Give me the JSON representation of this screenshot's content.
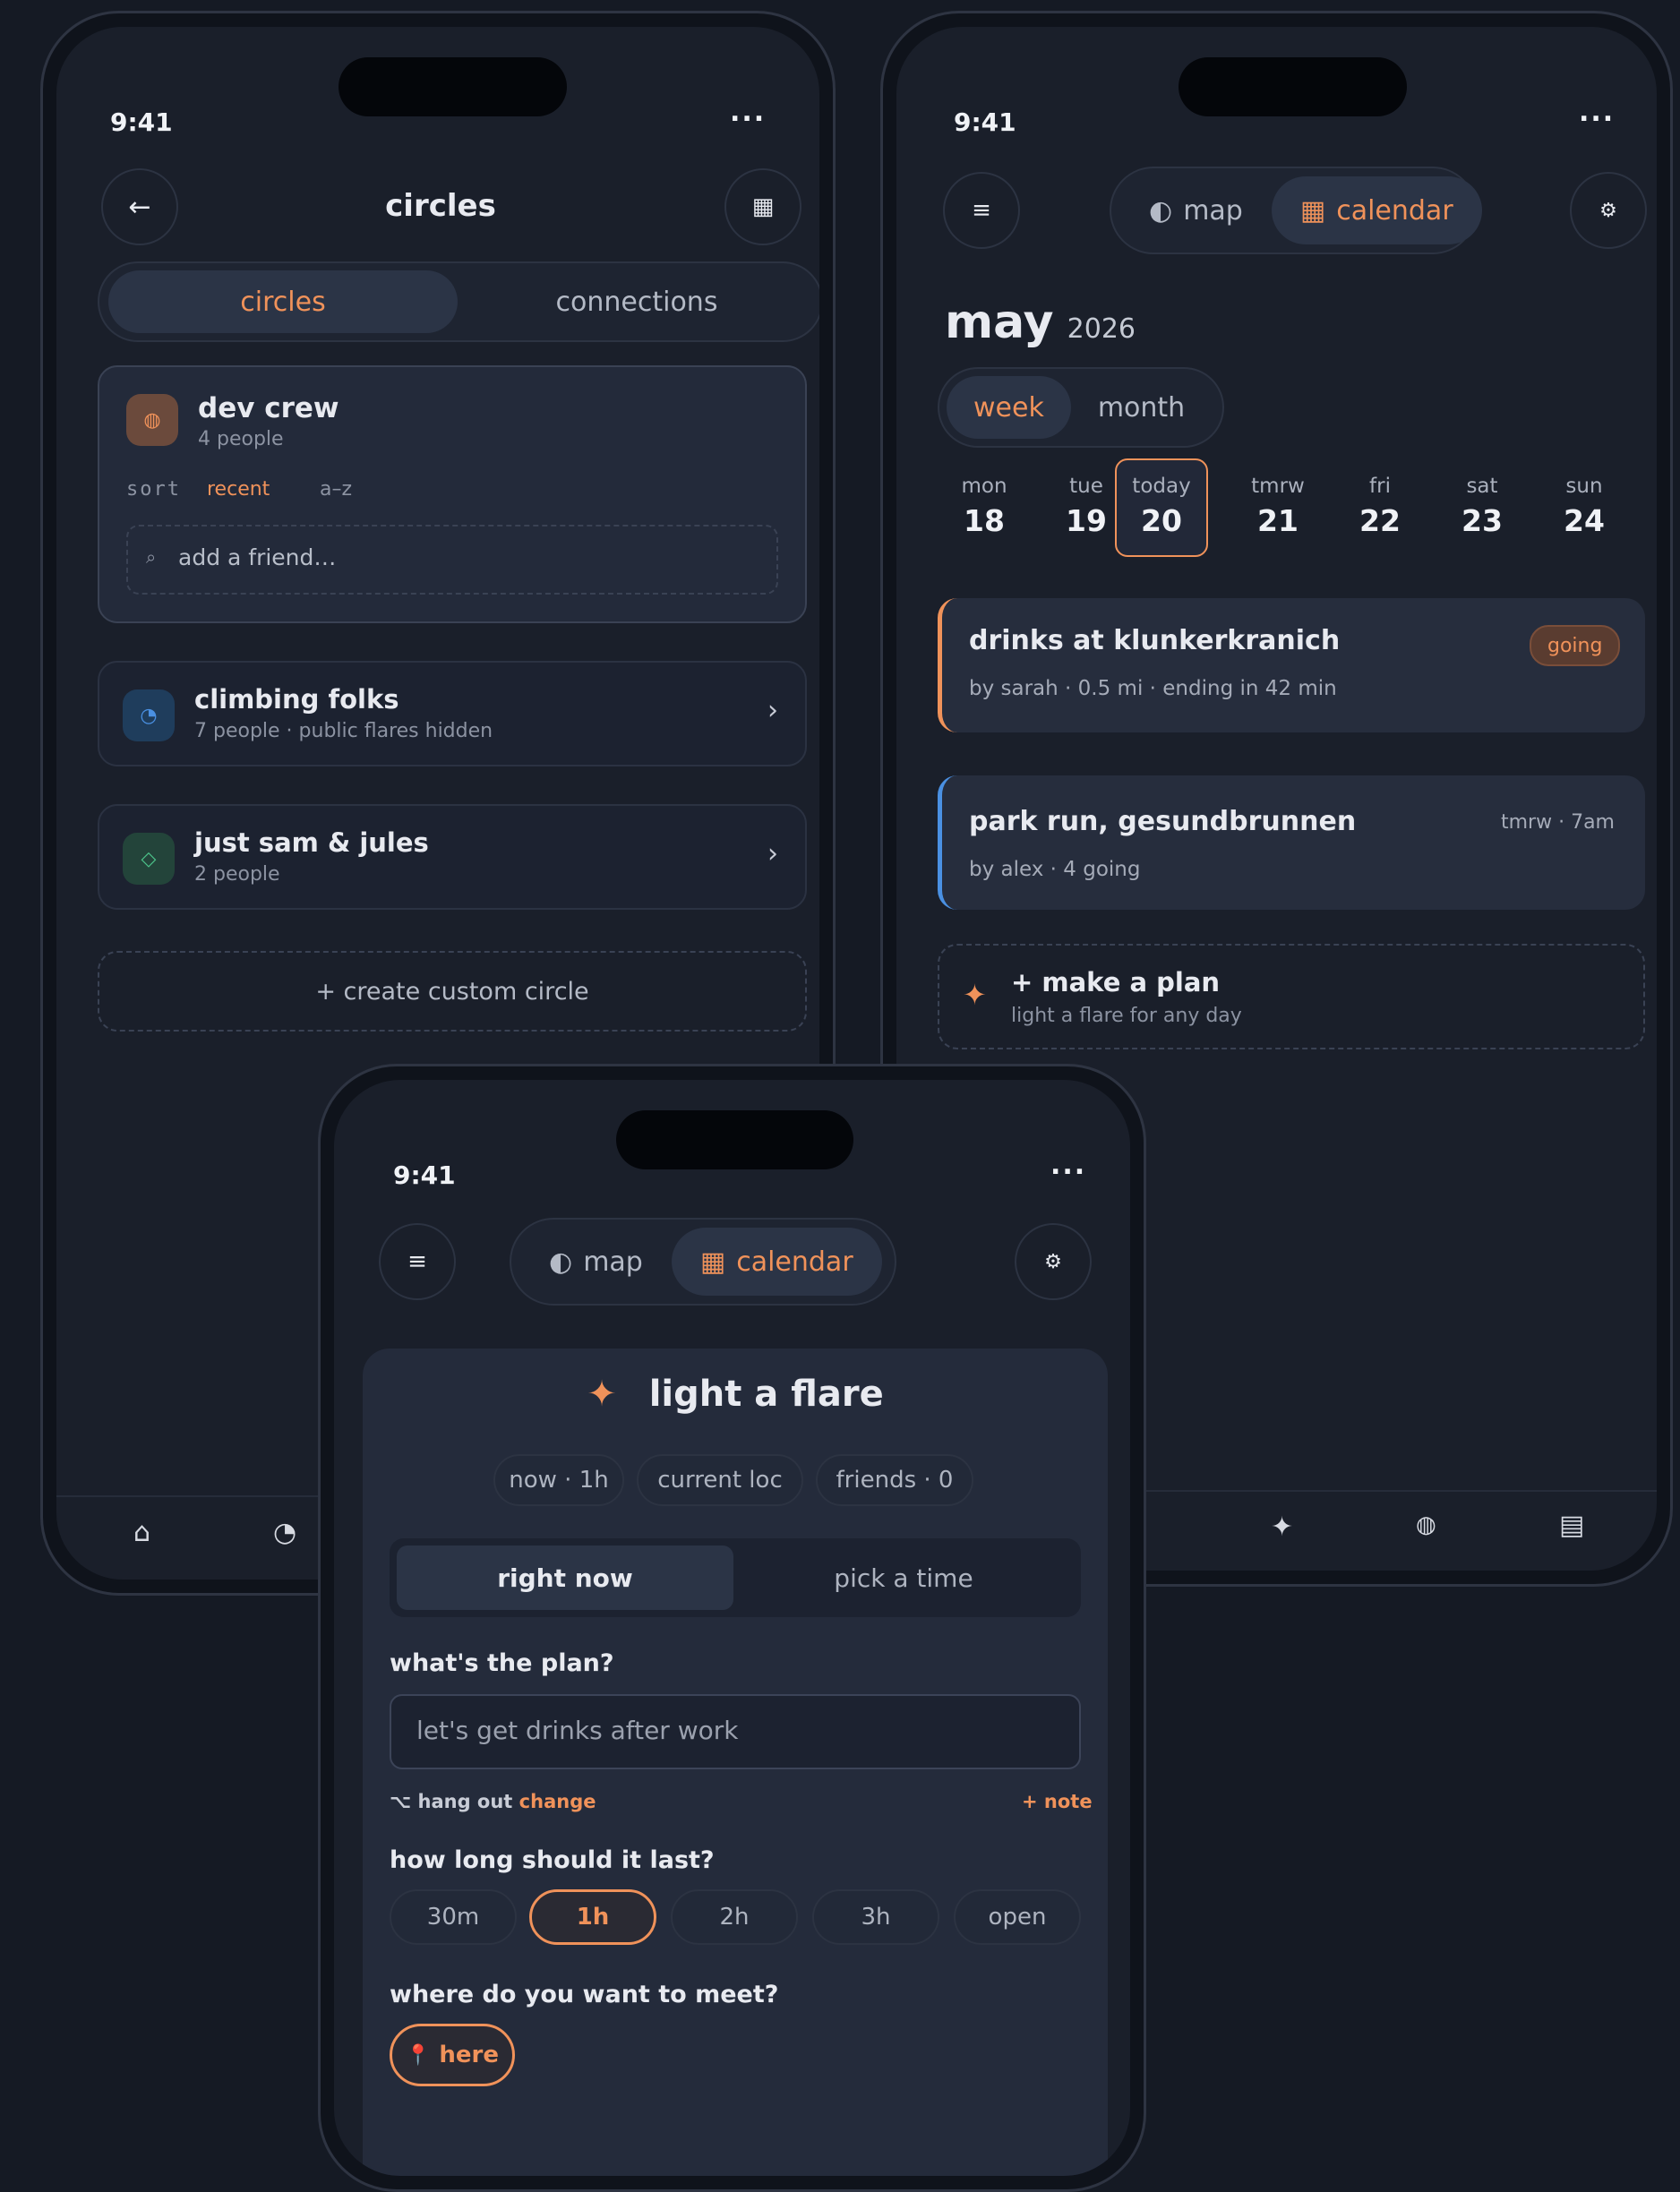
{
  "status": {
    "time": "9:41",
    "more": "..."
  },
  "circles_screen": {
    "title": "circles",
    "back_icon": "←",
    "grid_icon": "▦",
    "tabs": [
      {
        "label": "circles",
        "active": true
      },
      {
        "label": "connections",
        "active": false
      }
    ],
    "expanded_circle": {
      "name": "dev crew",
      "count": "4 people",
      "icon": "◍",
      "sort_label": "sort",
      "sort_options": [
        "recent",
        "a–z"
      ],
      "add_icon": "⌕",
      "add_placeholder": "add a friend…"
    },
    "circles": [
      {
        "name": "climbing folks",
        "meta": "7 people · public flares hidden",
        "icon": "◔",
        "chevron": "›"
      },
      {
        "name": "just sam & jules",
        "meta": "2 people",
        "icon": "◇",
        "chevron": "›"
      }
    ],
    "create_label": "+ create custom circle",
    "nav_icons": [
      "⌂",
      "◔"
    ]
  },
  "calendar_screen": {
    "menu_icon": "≡",
    "settings_icon": "⚙",
    "view_toggle": {
      "map_label": "map",
      "map_icon": "◐",
      "calendar_label": "calendar",
      "calendar_icon": "▦",
      "active": "calendar"
    },
    "month": "may",
    "year": "2026",
    "range_toggle": {
      "week": "week",
      "month": "month",
      "active": "week"
    },
    "days": [
      {
        "label": "mon",
        "num": "18"
      },
      {
        "label": "tue",
        "num": "19"
      },
      {
        "label": "today",
        "num": "20",
        "today": true
      },
      {
        "label": "tmrw",
        "num": "21"
      },
      {
        "label": "fri",
        "num": "22"
      },
      {
        "label": "sat",
        "num": "23"
      },
      {
        "label": "sun",
        "num": "24"
      }
    ],
    "events": [
      {
        "title": "drinks at klunkerkranich",
        "meta": "by sarah · 0.5 mi · ending in 42 min",
        "badge": "going",
        "accent": "#f0925a"
      },
      {
        "title": "park run, gesundbrunnen",
        "meta": "by alex · 4 going",
        "when": "tmrw · 7am",
        "accent": "#4a90e2"
      }
    ],
    "make_plan": {
      "icon": "✦",
      "title": "+ make a plan",
      "subtitle": "light a flare for any day"
    },
    "nav_icons": [
      "✦",
      "◍",
      "▤"
    ]
  },
  "flare_screen": {
    "menu_icon": "≡",
    "settings_icon": "⚙",
    "view_toggle": {
      "map_label": "map",
      "map_icon": "◐",
      "calendar_label": "calendar",
      "calendar_icon": "▦",
      "active": "calendar"
    },
    "sheet": {
      "icon": "✦",
      "title": "light a flare",
      "chips": [
        "now · 1h",
        "current loc",
        "friends · 0"
      ],
      "timing_tabs": [
        {
          "label": "right now",
          "active": true
        },
        {
          "label": "pick a time",
          "active": false
        }
      ],
      "plan_question": "what's the plan?",
      "plan_placeholder": "let's get drinks after work",
      "category_icon": "⌥",
      "category_label": "hang out",
      "category_change": "change",
      "note_link": "+ note",
      "duration_question": "how long should it last?",
      "durations": [
        {
          "label": "30m",
          "selected": false
        },
        {
          "label": "1h",
          "selected": true
        },
        {
          "label": "2h",
          "selected": false
        },
        {
          "label": "3h",
          "selected": false
        },
        {
          "label": "open",
          "selected": false
        }
      ],
      "meet_question": "where do you want to meet?",
      "meet_icon": "📍",
      "meet_label": "here"
    }
  },
  "colors": {
    "accent": "#f0925a",
    "background": "#151a24",
    "panel": "#1c2230",
    "blue": "#4a90e2"
  }
}
